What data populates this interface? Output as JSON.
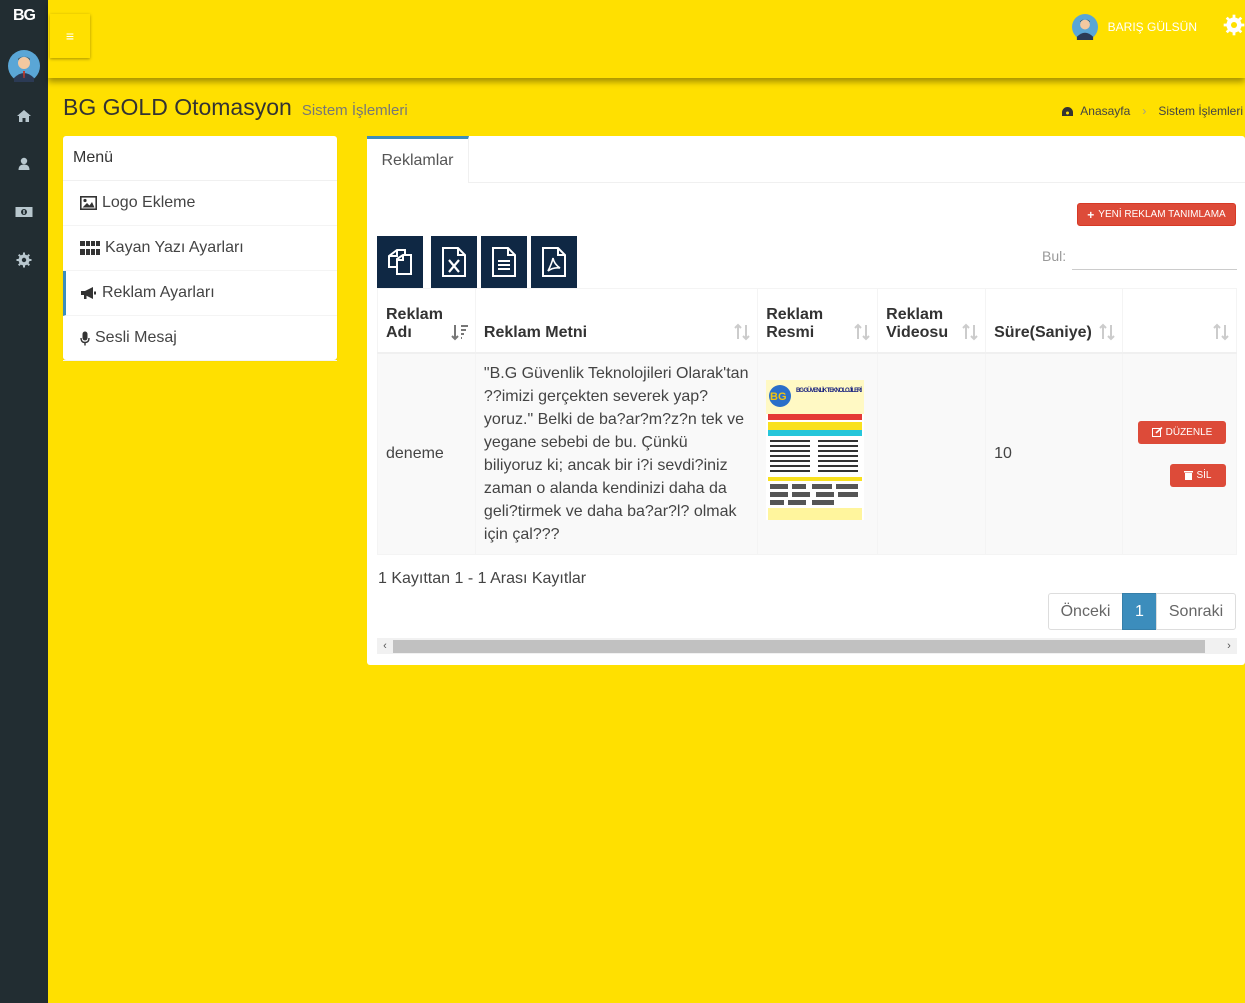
{
  "sidebar": {
    "logo": "BG",
    "icons": [
      "home-icon",
      "user-icon",
      "money-icon",
      "gear-icon"
    ]
  },
  "header": {
    "toggle_icon": "≡",
    "user_name": "BARIŞ GÜLSÜN"
  },
  "page": {
    "title": "BG GOLD Otomasyon",
    "subtitle": "Sistem İşlemleri"
  },
  "breadcrumb": {
    "home": "Anasayfa",
    "current": "Sistem İşlemleri"
  },
  "menu": {
    "title": "Menü",
    "items": [
      {
        "label": "Logo Ekleme",
        "icon": "image-icon"
      },
      {
        "label": "Kayan Yazı Ayarları",
        "icon": "grid-icon"
      },
      {
        "label": "Reklam Ayarları",
        "icon": "bullhorn-icon"
      },
      {
        "label": "Sesli Mesaj",
        "icon": "microphone-icon"
      }
    ]
  },
  "panel": {
    "tab": "Reklamlar",
    "new_button": "YENİ REKLAM TANIMLAMA",
    "search_label": "Bul:",
    "export_buttons": [
      "copy-icon",
      "excel-icon",
      "csv-icon",
      "pdf-icon"
    ],
    "table": {
      "headers": [
        "Reklam Adı",
        "Reklam Metni",
        "Reklam Resmi",
        "Reklam Videosu",
        "Süre(Saniye)",
        ""
      ],
      "rows": [
        {
          "name": "deneme",
          "text": "\"B.G Güvenlik Teknolojileri Olarak'tan ??imizi gerçekten severek yap?yoruz.\" Belki de ba?ar?m?z?n tek ve yegane sebebi de bu. Çünkü biliyoruz ki; ancak bir i?i sevdi?iniz zaman o alanda kendinizi daha da geli?tirmek ve daha ba?ar?l? olmak için çal???",
          "image_title": "BG GÜVENLİK TEKNOLOJİLERİ",
          "video": "",
          "duration": "10",
          "edit": "DÜZENLE",
          "delete": "SİL"
        }
      ]
    },
    "info": "1 Kayıttan 1 - 1 Arası Kayıtlar",
    "pager": {
      "prev": "Önceki",
      "current": "1",
      "next": "Sonraki"
    }
  }
}
